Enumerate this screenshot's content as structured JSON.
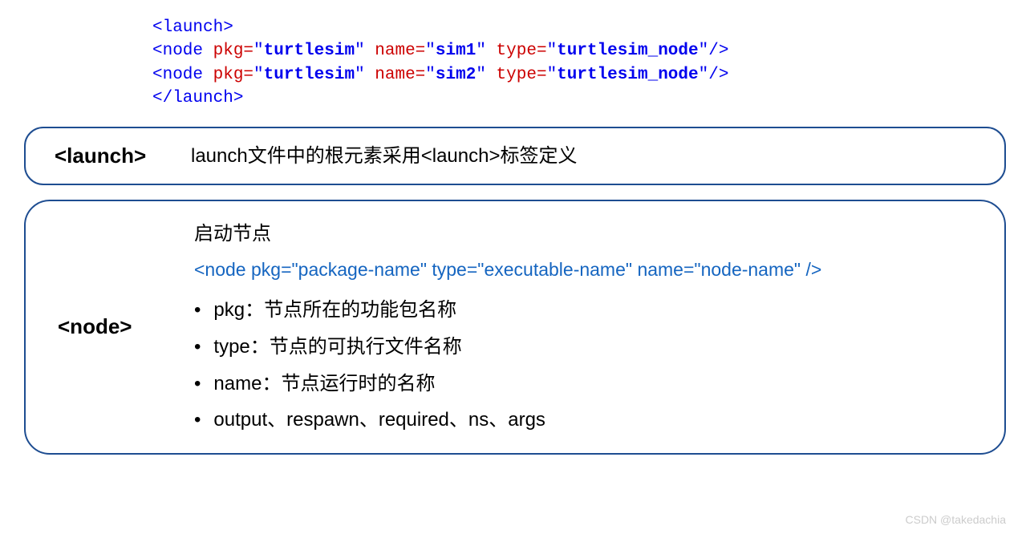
{
  "code": {
    "line1_open": "<launch>",
    "line2_indent": "  ",
    "node_open": "<node",
    "attr_pkg": " pkg=",
    "val_pkg_q1": "\"",
    "val_pkg": "turtlesim",
    "val_pkg_q2": "\"",
    "attr_name": " name=",
    "val_name1": "sim1",
    "val_name2": "sim2",
    "attr_type": " type=",
    "val_type": "turtlesim_node",
    "node_close": "/>",
    "line4_close": "</launch>"
  },
  "box1": {
    "label": "<launch>",
    "desc": "launch文件中的根元素采用<launch>标签定义"
  },
  "box2": {
    "label": "<node>",
    "title": "启动节点",
    "syntax": "<node pkg=\"package-name\" type=\"executable-name\" name=\"node-name\" />",
    "bullets": {
      "b1": "pkg：节点所在的功能包名称",
      "b2": "type：节点的可执行文件名称",
      "b3": "name：节点运行时的名称",
      "b4": "output、respawn、required、ns、args"
    }
  },
  "watermark": "CSDN @takedachia"
}
